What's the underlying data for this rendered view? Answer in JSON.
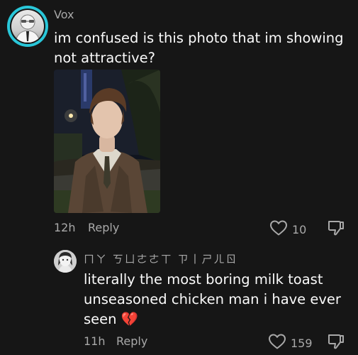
{
  "comment": {
    "username": "Vox",
    "text": "im confused is this photo that im showing not attractive?",
    "time": "12h",
    "reply_label": "Reply",
    "likes": "10"
  },
  "reply": {
    "username": "ㄇㄚ ㄎㄩㄜㄜㄒ ㄗ丨ㄕㄦㄖ",
    "text": "literally the most boring milk toast unseasoned chicken man i have ever seen 💔",
    "time": "11h",
    "reply_label": "Reply",
    "likes": "159"
  },
  "icons": {
    "like": "heart-outline-icon",
    "dislike": "thumbs-down-outline-icon",
    "broken_heart": "broken-heart-emoji"
  },
  "colors": {
    "background": "#161616",
    "avatar_ring": "#29c7d9",
    "secondary_text": "#a8a8a8"
  }
}
